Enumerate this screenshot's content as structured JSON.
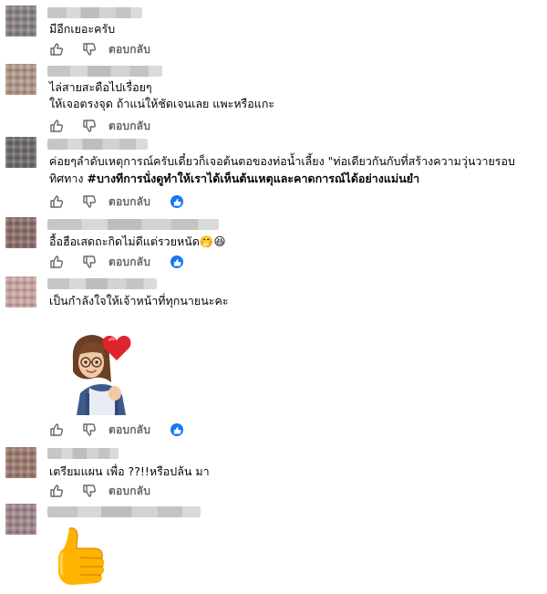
{
  "actions": {
    "reply_label": "ตอบกลับ"
  },
  "comments": [
    {
      "text": "มีอีกเยอะครับ",
      "liked": false
    },
    {
      "lines": [
        "ไล่สายสะดือไปเรื่อยๆ",
        "ให้เจอตรงจุด ถ้าแน่ให้ชัดเจนเลย แพะหรือแกะ"
      ],
      "liked": false
    },
    {
      "line1": "ค่อยๆลำดับเหตุการณ์ครับเดี๋ยวก็เจอต้นตอของท่อน้ำเลี้ยง \"ท่อเดียวกันกับที่สร้างความวุ่นวายรอบ",
      "line2_plain": "ทิศทาง ",
      "line2_bold": "#บางทีการนั่งดูทำให้เราได้เห็นต้นเหตุและคาดการณ์ได้อย่างแม่นยำ",
      "liked": true
    },
    {
      "text": "อื้อฮือเสดถะกิดไม่ดีแต่รวยหนัด",
      "emoji": "🤭😆",
      "liked": true
    },
    {
      "text": "เป็นกำลังใจให้เจ้าหน้าที่ทุกนายนะคะ",
      "sticker": "memoji-heart-sticker",
      "liked": true
    },
    {
      "text": "เตรียมแผน เพื่อ ??!!หรือปล้น มา",
      "liked": false
    },
    {
      "sticker": "thumbs-up-sticker"
    }
  ],
  "colors": {
    "link_blue": "#1877f2",
    "meta_grey": "#65676b",
    "text": "#050505"
  }
}
